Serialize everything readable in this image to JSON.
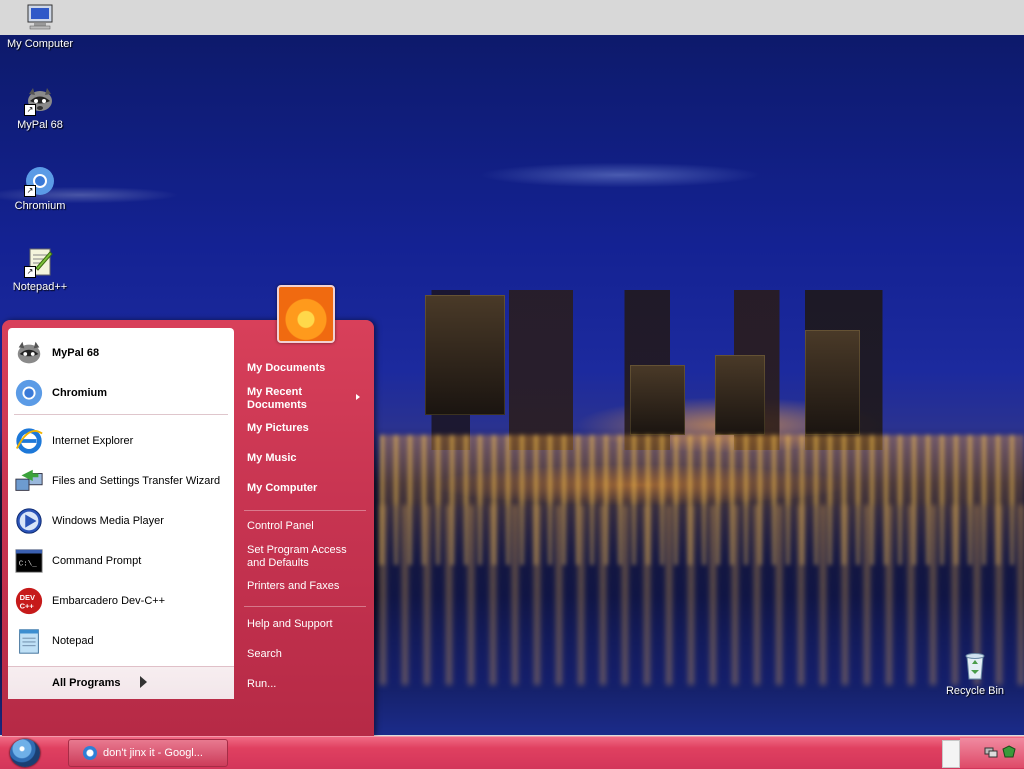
{
  "desktop": {
    "my_computer": {
      "label": "My Computer"
    },
    "icons": [
      {
        "label": "MyPal 68"
      },
      {
        "label": "Chromium"
      },
      {
        "label": "Notepad++"
      },
      {
        "label": "Recycle Bin"
      }
    ]
  },
  "start_menu": {
    "pinned": [
      {
        "label": "MyPal 68",
        "icon": "mypal-icon"
      },
      {
        "label": "Chromium",
        "icon": "chromium-icon"
      }
    ],
    "recent": [
      {
        "label": "Internet Explorer",
        "icon": "internet-explorer-icon"
      },
      {
        "label": "Files and Settings Transfer Wizard",
        "icon": "transfer-wizard-icon"
      },
      {
        "label": "Windows Media Player",
        "icon": "media-player-icon"
      },
      {
        "label": "Command Prompt",
        "icon": "command-prompt-icon"
      },
      {
        "label": "Embarcadero Dev-C++",
        "icon": "devcpp-icon"
      },
      {
        "label": "Notepad",
        "icon": "notepad-icon"
      }
    ],
    "all_programs": "All Programs",
    "right": {
      "my_documents": "My Documents",
      "my_recent_documents": "My Recent Documents",
      "my_pictures": "My Pictures",
      "my_music": "My Music",
      "my_computer": "My Computer",
      "control_panel": "Control Panel",
      "set_program_access": "Set Program Access and Defaults",
      "printers_faxes": "Printers and Faxes",
      "help_support": "Help and Support",
      "search": "Search",
      "run": "Run..."
    }
  },
  "taskbar": {
    "window_title": "don't jinx it - Googl..."
  },
  "colors": {
    "start_menu": "#c93552",
    "taskbar": "#e04060",
    "desktop_sky": "#142293"
  }
}
